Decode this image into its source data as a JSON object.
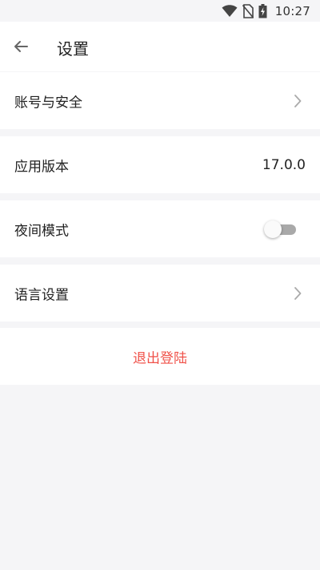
{
  "status_bar": {
    "time": "10:27",
    "icons": [
      "wifi-icon",
      "no-sim-icon",
      "battery-charging-icon"
    ]
  },
  "app_bar": {
    "title": "设置",
    "back_icon": "arrow-left-icon"
  },
  "settings": {
    "account_security": {
      "label": "账号与安全",
      "icon": "chevron-right-icon"
    },
    "app_version": {
      "label": "应用版本",
      "value": "17.0.0"
    },
    "night_mode": {
      "label": "夜间模式",
      "enabled": false
    },
    "language": {
      "label": "语言设置",
      "icon": "chevron-right-icon"
    }
  },
  "logout": {
    "label": "退出登陆",
    "color": "#f0524a"
  },
  "colors": {
    "background": "#f5f5f7",
    "card": "#ffffff",
    "toggle_off": "#a9a9a9"
  }
}
